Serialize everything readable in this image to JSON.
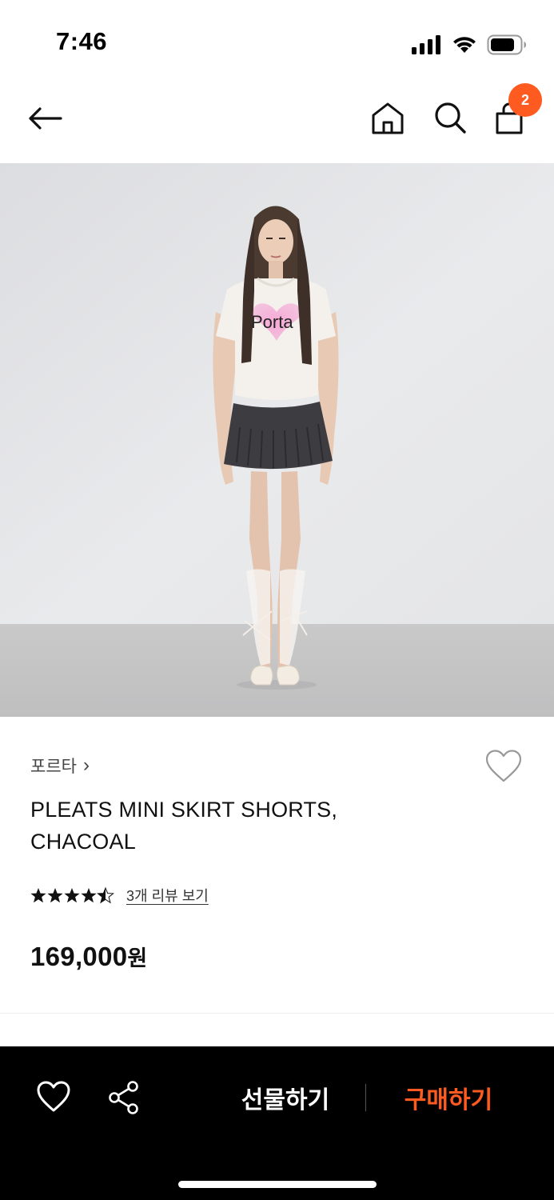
{
  "status_bar": {
    "time": "7:46",
    "icons": [
      "signal-icon",
      "wifi-icon",
      "battery-icon"
    ]
  },
  "nav": {
    "icons": [
      "back-arrow-icon",
      "home-icon",
      "search-icon",
      "shopping-bag-icon"
    ],
    "cart_count": "2"
  },
  "product": {
    "image_print_text": "Porta",
    "brand": "포르타",
    "brand_chevron": "›",
    "title": "PLEATS MINI SKIRT SHORTS, CHACOAL",
    "rating": 4.5,
    "rating_max": 5,
    "review_link": "3개 리뷰 보기",
    "price": "169,000",
    "price_unit": "원"
  },
  "bottom_bar": {
    "gift_label": "선물하기",
    "buy_label": "구매하기",
    "icons": [
      "heart-icon",
      "share-icon"
    ]
  },
  "colors": {
    "accent": "#ff5a1f",
    "bottom_bar_bg": "#000000",
    "text": "#111111"
  }
}
